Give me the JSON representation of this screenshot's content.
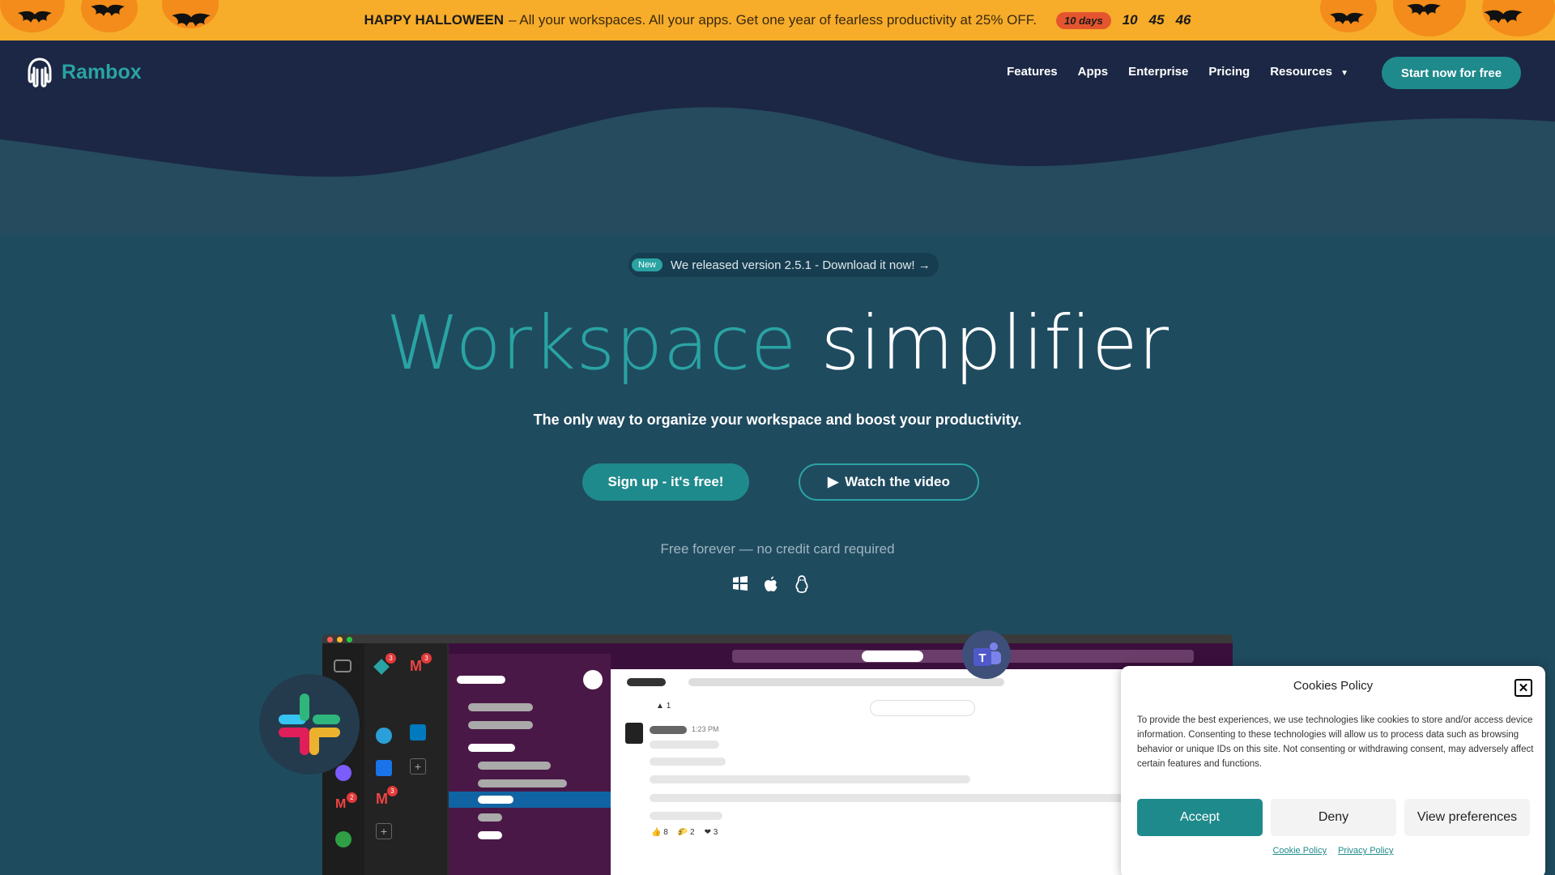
{
  "banner": {
    "title": "HAPPY HALLOWEEN",
    "message": "– All your workspaces. All your apps. Get one year of fearless productivity at 25% OFF.",
    "days": "10 days",
    "hours": "10",
    "minutes": "45",
    "seconds": "46"
  },
  "nav": {
    "logo": "Rambox",
    "links": [
      "Features",
      "Apps",
      "Enterprise",
      "Pricing",
      "Resources"
    ],
    "cta": "Start now for free"
  },
  "hero": {
    "release_badge": "New",
    "release_text": "We released version 2.5.1 - Download it now! →",
    "headline_accent": "Workspace",
    "headline_rest": "simplifier",
    "subtitle": "The only way to organize your workspace and boost your productivity.",
    "primary_button": "Sign up - it's free!",
    "secondary_button": "Watch the video",
    "free_note": "Free forever — no credit card required",
    "os_icons": [
      "windows-icon",
      "apple-icon",
      "linux-icon"
    ]
  },
  "app_preview": {
    "timestamp": "1:23 PM",
    "reactions": [
      "8",
      "2",
      "3"
    ],
    "reaction_top": "1",
    "badges": [
      "3",
      "3",
      "3",
      "2",
      "1"
    ]
  },
  "cookie": {
    "title": "Cookies Policy",
    "text": "To provide the best experiences, we use technologies like cookies to store and/or access device information. Consenting to these technologies will allow us to process data such as browsing behavior or unique IDs on this site. Not consenting or withdrawing consent, may adversely affect certain features and functions.",
    "accept": "Accept",
    "deny": "Deny",
    "preferences": "View preferences",
    "link_cookie": "Cookie Policy",
    "link_privacy": "Privacy Policy"
  },
  "colors": {
    "accent": "#2aa3a3",
    "banner": "#f7ac2a",
    "nav": "#1b2744",
    "hero": "#1f4b5f"
  }
}
